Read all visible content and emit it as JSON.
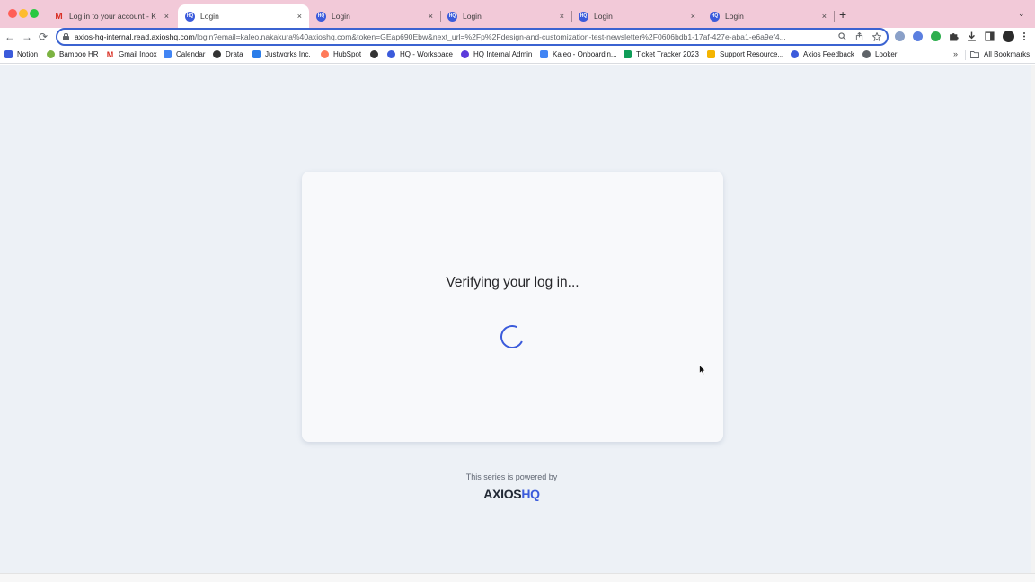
{
  "tabs": [
    {
      "title": "Log in to your account - K",
      "favicon": "gmail-icon",
      "active": false
    },
    {
      "title": "Login",
      "favicon": "axioshq-favicon",
      "active": true
    },
    {
      "title": "Login",
      "favicon": "axioshq-favicon",
      "active": false
    },
    {
      "title": "Login",
      "favicon": "axioshq-favicon",
      "active": false
    },
    {
      "title": "Login",
      "favicon": "axioshq-favicon",
      "active": false
    },
    {
      "title": "Login",
      "favicon": "axioshq-favicon",
      "active": false
    }
  ],
  "tab_close_glyph": "×",
  "favicon_text": "HQ",
  "new_tab_glyph": "+",
  "tab_search_glyph": "⌄",
  "toolbar": {
    "back_glyph": "←",
    "forward_glyph": "→",
    "reload_glyph": "⟳",
    "url_host": "axios-hq-internal.read.axioshq.com",
    "url_path": "/login?email=kaleo.nakakura%40axioshq.com&token=GEap690Ebw&next_url=%2Fp%2Fdesign-and-customization-test-newsletter%2F0606bdb1-17af-427e-aba1-e6a9ef4..."
  },
  "bookmarks": [
    {
      "label": "Notion",
      "icon": "notion-icon",
      "color": "#3b5bdb"
    },
    {
      "label": "Bamboo HR",
      "icon": "bamboohr-icon",
      "color": "#7cb342"
    },
    {
      "label": "Gmail Inbox",
      "icon": "gmail-icon",
      "color": "#d93025"
    },
    {
      "label": "Calendar",
      "icon": "calendar-icon",
      "color": "#4285f4"
    },
    {
      "label": "Drata",
      "icon": "drata-icon",
      "color": "#333333"
    },
    {
      "label": "Justworks Inc.",
      "icon": "justworks-icon",
      "color": "#2b7de9"
    },
    {
      "label": "HubSpot",
      "icon": "hubspot-icon",
      "color": "#ff7a59"
    },
    {
      "label": "",
      "icon": "globe-icon",
      "color": "#333333"
    },
    {
      "label": "HQ - Workspace",
      "icon": "axioshq-icon",
      "color": "#3b5bdb"
    },
    {
      "label": "HQ Internal Admin",
      "icon": "axioshq-icon",
      "color": "#5b3bdb"
    },
    {
      "label": "Kaleo - Onboardin...",
      "icon": "docs-icon",
      "color": "#4285f4"
    },
    {
      "label": "Ticket Tracker 2023",
      "icon": "sheets-icon",
      "color": "#0f9d58"
    },
    {
      "label": "Support Resource...",
      "icon": "support-icon",
      "color": "#f4b400"
    },
    {
      "label": "Axios Feedback",
      "icon": "axioshq-icon",
      "color": "#3b5bdb"
    },
    {
      "label": "Looker",
      "icon": "looker-icon",
      "color": "#5f6368"
    }
  ],
  "bookmarks_more_glyph": "»",
  "all_bookmarks": "All Bookmarks",
  "page": {
    "title": "Verifying your log in...",
    "powered_by": "This series is powered by",
    "logo_axios": "AXIOS",
    "logo_hq": "HQ"
  },
  "colors": {
    "accent": "#3b5bdb",
    "tabstrip": "#f2c9d8",
    "page_background": "#edf1f6",
    "card_background": "#f8f9fb"
  }
}
